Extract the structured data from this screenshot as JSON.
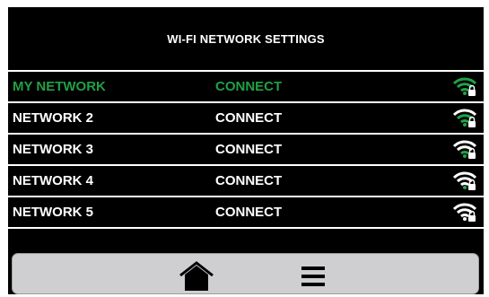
{
  "header": {
    "title": "WI-FI NETWORK SETTINGS"
  },
  "networks": [
    {
      "name": "MY NETWORK",
      "action": "CONNECT",
      "active": true,
      "icon": "wifi-locked-icon"
    },
    {
      "name": "NETWORK 2",
      "action": "CONNECT",
      "active": false,
      "icon": "wifi-locked-icon"
    },
    {
      "name": "NETWORK 3",
      "action": "CONNECT",
      "active": false,
      "icon": "wifi-locked-icon"
    },
    {
      "name": "NETWORK 4",
      "action": "CONNECT",
      "active": false,
      "icon": "wifi-locked-icon"
    },
    {
      "name": "NETWORK 5",
      "action": "CONNECT",
      "active": false,
      "icon": "wifi-locked-icon"
    }
  ],
  "toolbar": {
    "home_icon": "home-icon",
    "menu_icon": "hamburger-menu-icon"
  },
  "colors": {
    "background": "#000000",
    "text": "#ffffff",
    "active": "#21a046",
    "wifi_full": "#21a046",
    "toolbar_bg": "#cfcfd1"
  }
}
